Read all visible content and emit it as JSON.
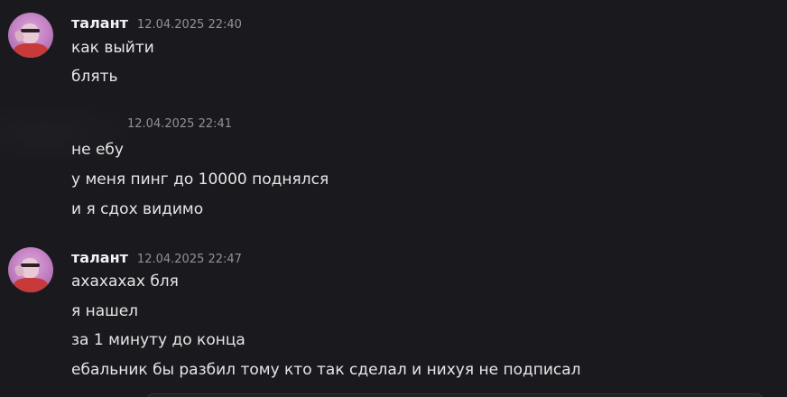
{
  "messages": [
    {
      "username": "талант",
      "timestamp": "12.04.2025 22:40",
      "lines": [
        "как выйти",
        "блять"
      ]
    },
    {
      "username": "",
      "timestamp": "12.04.2025 22:41",
      "lines": [
        "не ебу",
        "у меня пинг до 10000 поднялся",
        "и я сдох видимо"
      ]
    },
    {
      "username": "талант",
      "timestamp": "12.04.2025 22:47",
      "lines": [
        "ахахахах бля",
        "я нашел",
        "за 1 минуту до конца",
        "ебальник бы разбил тому кто так сделал и нихуя не подписал"
      ]
    }
  ]
}
